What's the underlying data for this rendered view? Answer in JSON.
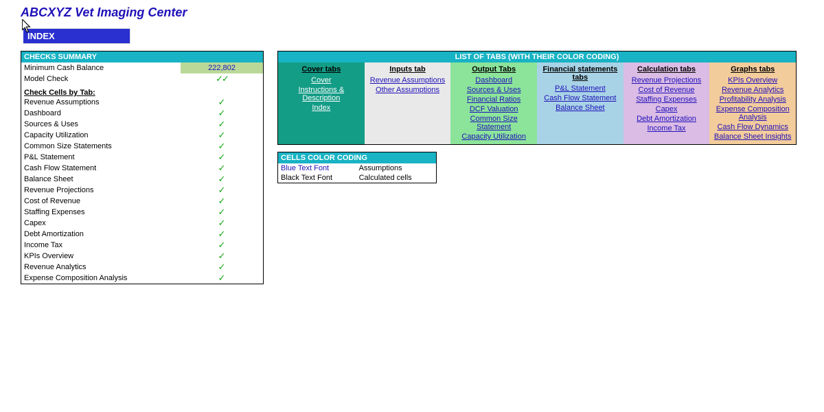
{
  "header": {
    "title": "ABCXYZ Vet Imaging Center",
    "index_badge": "INDEX"
  },
  "checks": {
    "title": "CHECKS SUMMARY",
    "min_cash_label": "Minimum Cash Balance",
    "min_cash_value": "222,802",
    "model_check_label": "Model Check",
    "subhead": "Check Cells by Tab:",
    "rows": [
      "Revenue Assumptions",
      "Dashboard",
      "Sources & Uses",
      "Capacity Utilization",
      "Common Size Statements",
      "P&L Statement",
      "Cash Flow Statement",
      "Balance Sheet",
      "Revenue Projections",
      "Cost of Revenue",
      "Staffing Expenses",
      "Capex",
      "Debt Amortization",
      "Income Tax",
      "KPIs Overview",
      "Revenue Analytics",
      "Expense Composition Analysis"
    ]
  },
  "tabs": {
    "title": "LIST OF TABS (WITH THEIR COLOR CODING)",
    "columns": [
      {
        "head": "Cover tabs",
        "cls": "c-cover",
        "white": true,
        "items": [
          "Cover",
          "Instructions & Description",
          "Index"
        ]
      },
      {
        "head": "Inputs tab",
        "cls": "c-inputs",
        "items": [
          "Revenue Assumptions",
          "Other Assumptions"
        ]
      },
      {
        "head": "Output Tabs",
        "cls": "c-output",
        "items": [
          "Dashboard",
          "Sources & Uses",
          "Financial Ratios",
          "DCF Valuation",
          "Common Size Statement",
          "Capacity Utilization"
        ]
      },
      {
        "head": "Financial statements tabs",
        "cls": "c-fin",
        "items": [
          "P&L Statement",
          "Cash Flow Statement",
          "Balance Sheet"
        ]
      },
      {
        "head": "Calculation tabs",
        "cls": "c-calc",
        "items": [
          "Revenue Projections",
          "Cost of Revenue",
          "Staffing Expenses",
          "Capex",
          "Debt Amortization",
          "Income Tax"
        ]
      },
      {
        "head": "Graphs tabs",
        "cls": "c-graphs",
        "items": [
          "KPIs Overview",
          "Revenue Analytics",
          "Profitability Analysis",
          "Expense Composition Analysis",
          "Cash Flow Dynamics",
          "Balance Sheet Insights"
        ]
      }
    ]
  },
  "coding": {
    "title": "CELLS COLOR CODING",
    "blue_label": "Blue Text Font",
    "blue_desc": "Assumptions",
    "black_label": "Black Text Font",
    "black_desc": "Calculated cells"
  }
}
